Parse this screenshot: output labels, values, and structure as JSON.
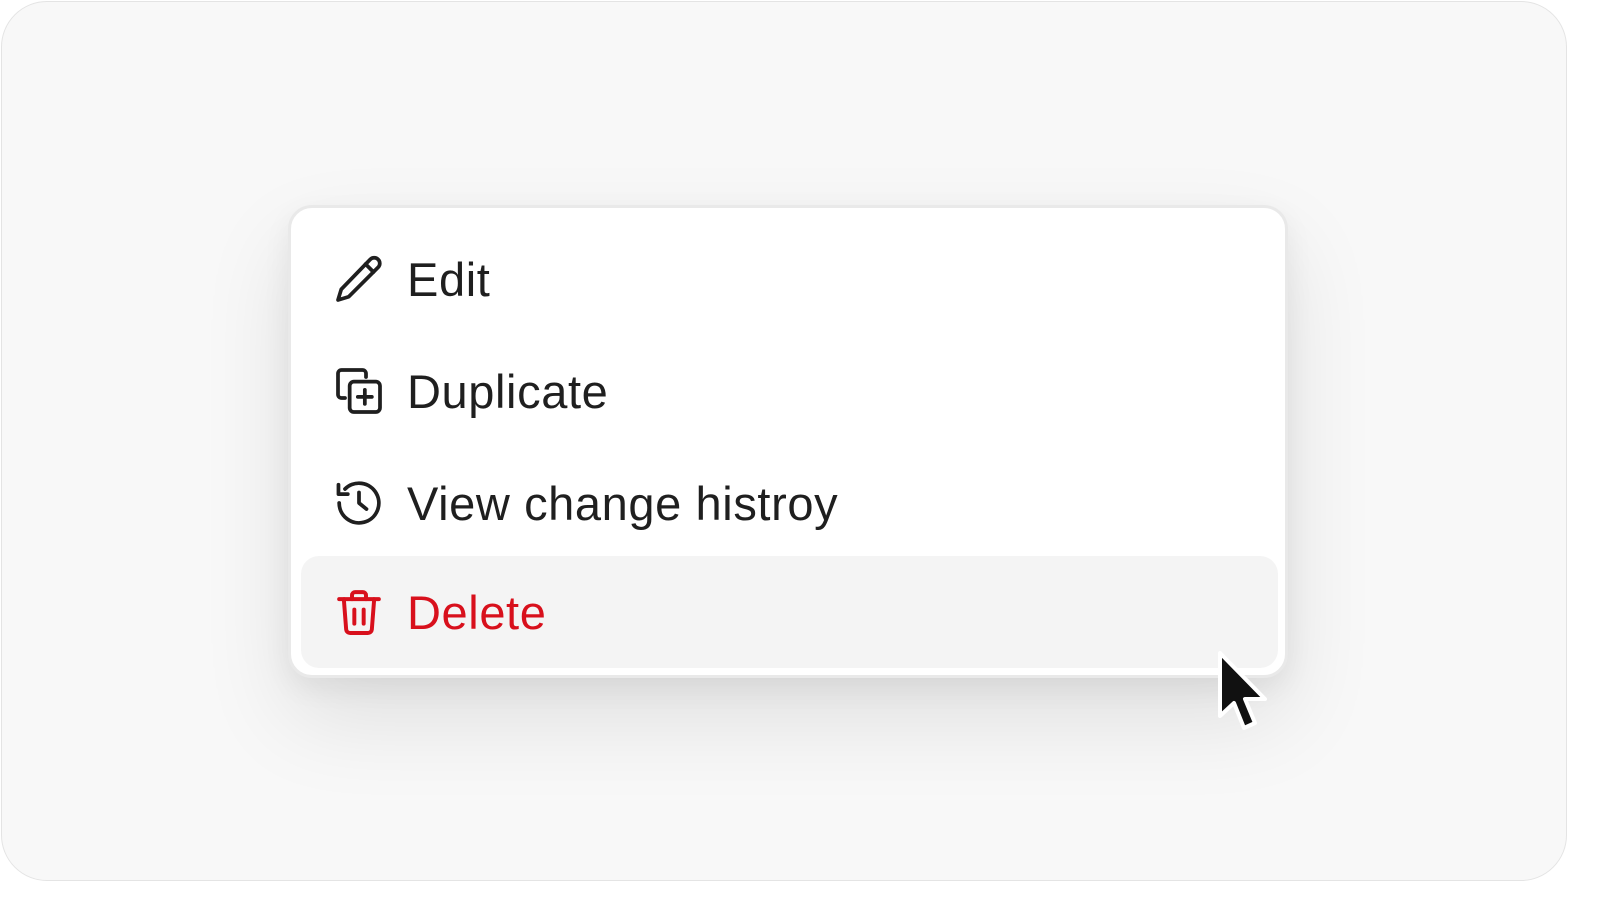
{
  "menu": {
    "items": [
      {
        "label": "Edit",
        "icon": "pencil-icon"
      },
      {
        "label": "Duplicate",
        "icon": "duplicate-icon"
      },
      {
        "label": "View change histroy",
        "icon": "history-icon"
      },
      {
        "label": "Delete",
        "icon": "trash-icon",
        "hovered": true
      }
    ]
  },
  "colors": {
    "text": "#1f1f1f",
    "danger": "#d8101c",
    "hover_bg": "#f4f4f4",
    "menu_border": "#e9e9e9",
    "background": "#f8f8f8"
  }
}
